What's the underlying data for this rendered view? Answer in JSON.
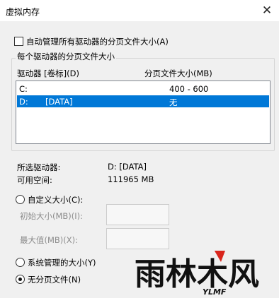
{
  "window": {
    "title": "虚拟内存",
    "close_glyph": "✕"
  },
  "auto_manage": {
    "label": "自动管理所有驱动器的分页文件大小(A)",
    "checked": false
  },
  "group": {
    "legend": "每个驱动器的分页文件大小",
    "col_drive": "驱动器 [卷标](D)",
    "col_size": "分页文件大小(MB)",
    "rows": [
      {
        "drive": "C:",
        "label": "",
        "size": "400 - 600"
      },
      {
        "drive": "D:",
        "label": "[DATA]",
        "size": "无"
      }
    ],
    "selected_index": 1
  },
  "info": {
    "selected_drive_label": "所选驱动器:",
    "selected_drive_value": "D:  [DATA]",
    "free_space_label": "可用空间:",
    "free_space_value": "111965 MB"
  },
  "options": {
    "custom_label": "自定义大小(C):",
    "initial_label": "初始大小(MB)(I):",
    "max_label": "最大值(MB)(X):",
    "system_label": "系统管理的大小(Y)",
    "none_label": "无分页文件(N)",
    "selected": "none"
  },
  "watermark": {
    "text": "雨林木风",
    "sub": "YLMF"
  },
  "colors": {
    "selection": "#0078d7",
    "background": "#f0f0f0",
    "watermark_red": "#d9261c"
  }
}
